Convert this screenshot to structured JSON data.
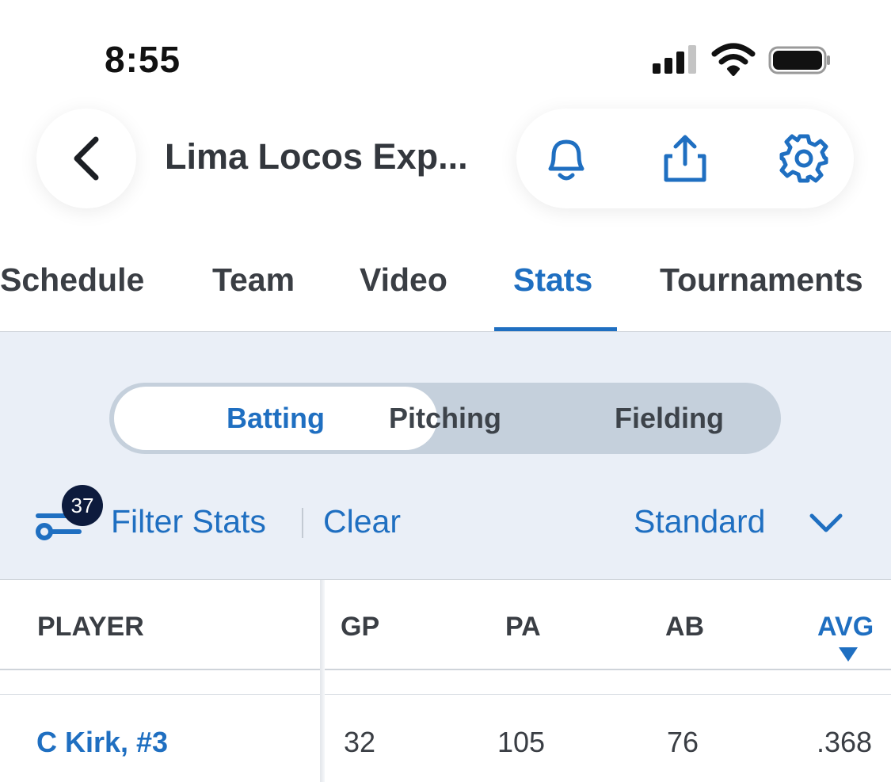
{
  "status_bar": {
    "time": "8:55",
    "icons": [
      "cellular-signal-icon",
      "wifi-icon",
      "battery-icon"
    ]
  },
  "nav": {
    "title": "Lima Locos Exp...",
    "back_icon": "chevron-left-icon",
    "actions": [
      "bell-icon",
      "share-icon",
      "gear-icon"
    ]
  },
  "tabs": [
    {
      "label": "Schedule",
      "active": false
    },
    {
      "label": "Team",
      "active": false
    },
    {
      "label": "Video",
      "active": false
    },
    {
      "label": "Stats",
      "active": true
    },
    {
      "label": "Tournaments",
      "active": false
    }
  ],
  "stat_type": {
    "options": [
      "Batting",
      "Pitching",
      "Fielding"
    ],
    "selected": "Batting"
  },
  "filter": {
    "badge_count": "37",
    "filter_label": "Filter Stats",
    "clear_label": "Clear",
    "view_selected": "Standard"
  },
  "table": {
    "columns": [
      "PLAYER",
      "GP",
      "PA",
      "AB",
      "AVG"
    ],
    "sorted_column": "AVG",
    "sort_direction": "descending",
    "rows": [
      {
        "player": "C Kirk, #3",
        "gp": "32",
        "pa": "105",
        "ab": "76",
        "avg": ".368"
      }
    ]
  },
  "colors": {
    "accent": "#1f6fc1",
    "panel_bg": "#eaeff7",
    "badge_bg": "#0d1b3d",
    "segment_bg": "#c5d0dc"
  }
}
